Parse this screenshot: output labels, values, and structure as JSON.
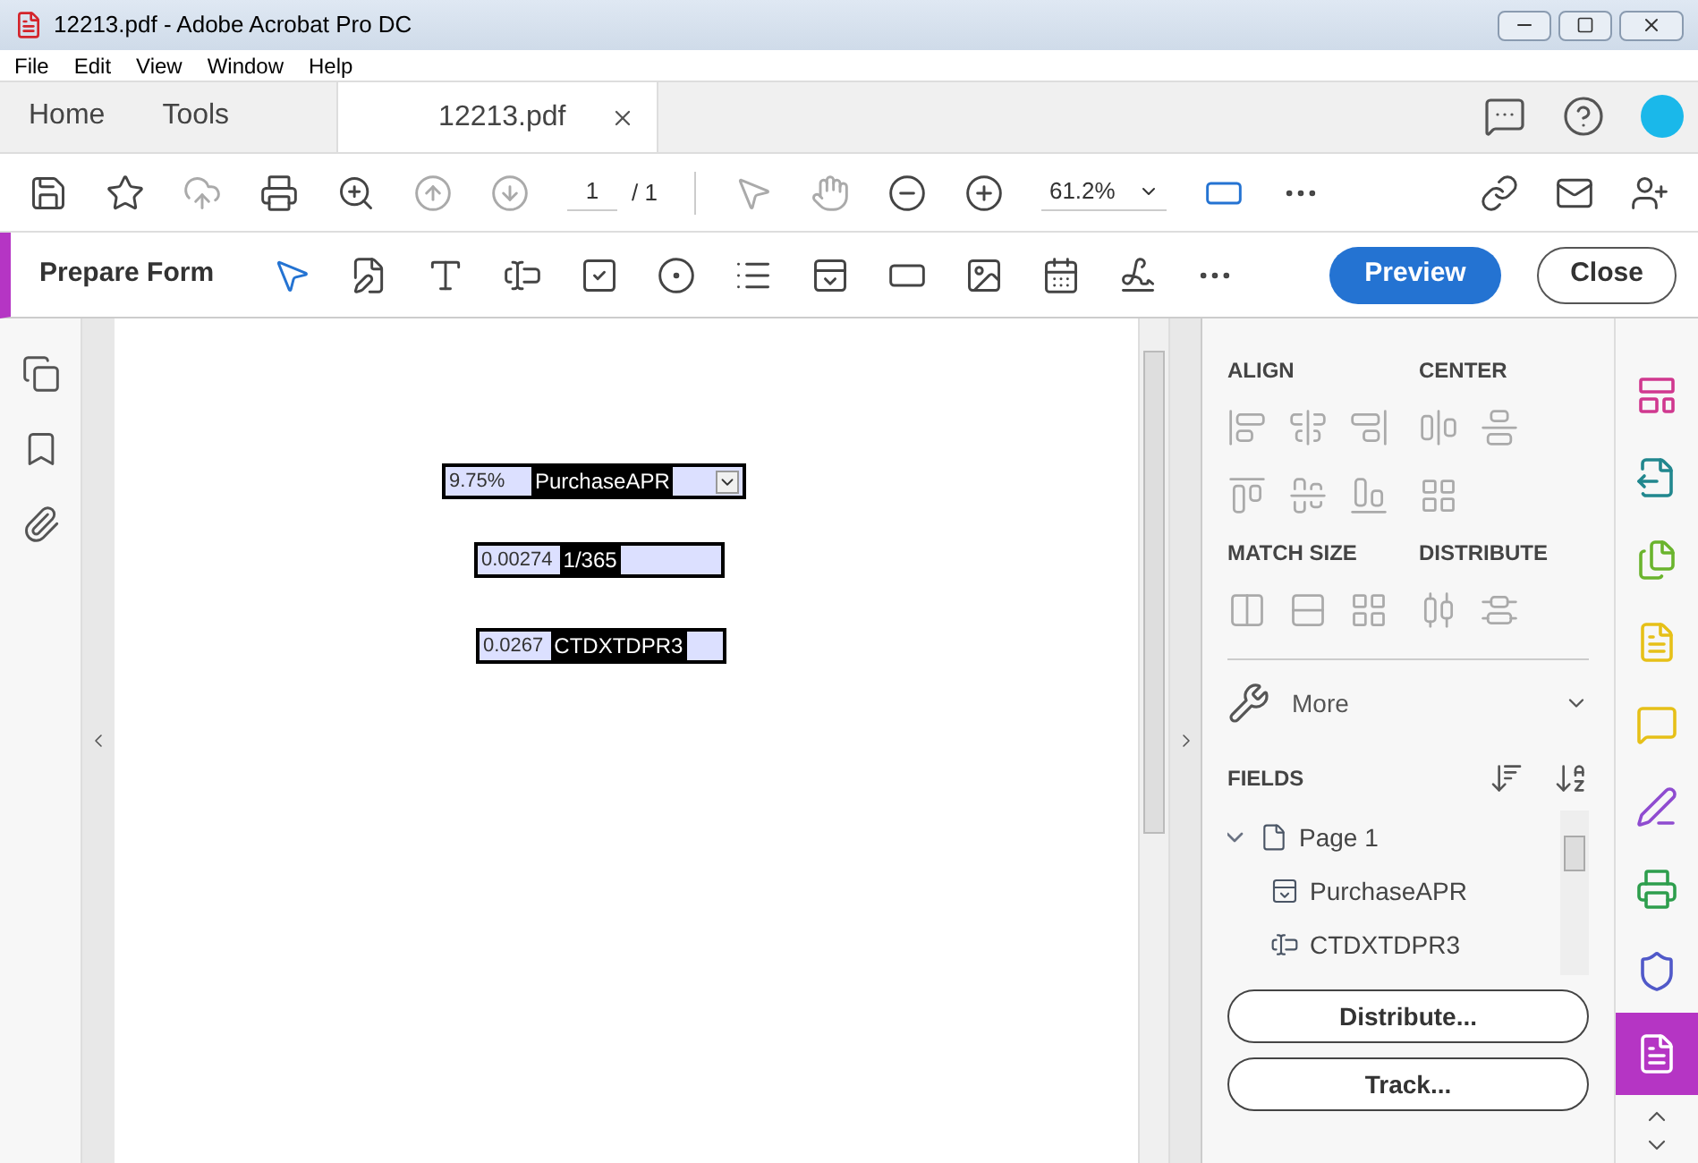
{
  "window": {
    "title": "12213.pdf - Adobe Acrobat Pro DC"
  },
  "menu": [
    "File",
    "Edit",
    "View",
    "Window",
    "Help"
  ],
  "tabs": [
    {
      "label": "Home",
      "selected": false
    },
    {
      "label": "Tools",
      "selected": false
    },
    {
      "label": "12213.pdf",
      "selected": true
    }
  ],
  "toolbar": {
    "icons": [
      {
        "kind": "save",
        "disabled": false
      },
      {
        "kind": "star",
        "disabled": false
      },
      {
        "kind": "upload",
        "disabled": true
      },
      {
        "kind": "print",
        "disabled": false
      },
      {
        "kind": "zoom",
        "disabled": false
      },
      {
        "kind": "up",
        "disabled": true
      },
      {
        "kind": "down",
        "disabled": true
      }
    ],
    "page": "1",
    "page_total": "/ 1",
    "tools": [
      {
        "kind": "pointer",
        "disabled": true
      },
      {
        "kind": "hand",
        "disabled": true
      },
      {
        "kind": "minus",
        "disabled": false
      },
      {
        "kind": "plus",
        "disabled": false
      }
    ],
    "zoom": "61.2%"
  },
  "prepare_form": {
    "title": "Prepare Form",
    "preview": "Preview",
    "close": "Close"
  },
  "form_fields": [
    {
      "value": "9.75%",
      "name": "PurchaseAPR",
      "kind": "dropdown"
    },
    {
      "value": "0.00274",
      "name": "1/365",
      "kind": "text"
    },
    {
      "value": "0.0267",
      "name": "CTDXTDPR3",
      "kind": "text"
    }
  ],
  "panel": {
    "align": "ALIGN",
    "center": "CENTER",
    "match_size": "MATCH SIZE",
    "distribute": "DISTRIBUTE",
    "more": "More",
    "fields": "FIELDS",
    "tree": [
      {
        "label": "Page 1",
        "kind": "page",
        "expanded": true,
        "children": [
          {
            "label": "PurchaseAPR",
            "kind": "dropdown"
          },
          {
            "label": "CTDXTDPR3",
            "kind": "text"
          }
        ]
      }
    ],
    "buttons": [
      "Distribute...",
      "Track..."
    ]
  },
  "rail": [
    {
      "kind": "organize",
      "color": "#d0388f",
      "selected": false
    },
    {
      "kind": "export",
      "color": "#21878e",
      "selected": false
    },
    {
      "kind": "combine",
      "color": "#6ab42d",
      "selected": false
    },
    {
      "kind": "comment-doc",
      "color": "#e6c018",
      "selected": false
    },
    {
      "kind": "comment",
      "color": "#e6c018",
      "selected": false
    },
    {
      "kind": "sign",
      "color": "#8f4cd0",
      "selected": false
    },
    {
      "kind": "print",
      "color": "#2e9e4d",
      "selected": false
    },
    {
      "kind": "protect",
      "color": "#5059c9",
      "selected": false
    },
    {
      "kind": "form",
      "color": "#b535c4",
      "selected": true
    }
  ]
}
